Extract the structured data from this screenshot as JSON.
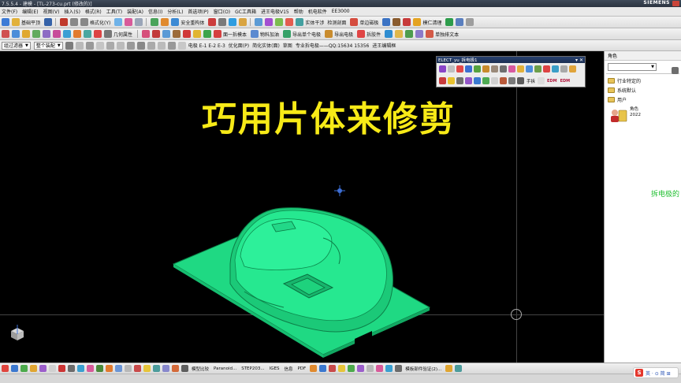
{
  "window": {
    "title": "7.5.5.4 - 建模 - [TL-273-cu.prt  (修改的)]",
    "brand": "SIEMENS"
  },
  "menu": [
    "文件(F)",
    "编辑(E)",
    "视图(V)",
    "插入(S)",
    "格式(R)",
    "工具(T)",
    "装配(A)",
    "信息(I)",
    "分析(L)",
    "首选项(P)",
    "窗口(O)",
    "GC工具箱",
    "进王电极V15",
    "帮助",
    "机电软件",
    "EE3000"
  ],
  "toolbar1": {
    "labels": [
      "基础平顶",
      "格式化(Y)",
      "安全重构体",
      "实体干涉",
      "检测剖面",
      "单边磁极",
      "模仁清理"
    ]
  },
  "toolbar2": {
    "labels": [
      "几何属性",
      "面一拆模本",
      "物料加油",
      "导出单个电极",
      "导出电极",
      "拆胶件",
      "单独排文本"
    ]
  },
  "toolbar3": {
    "filter": "整个装配",
    "filter_left": "组过滤器",
    "labels": [
      "电极  E-1  E-2  E-3",
      "优化面(P)",
      "简化实体(面)",
      "草图",
      "专业拆电极——QQ:15634 15356",
      "进王编辑框"
    ]
  },
  "elect_toolbar": {
    "title": "ELECT_yu_拆电极1",
    "text": "手拆",
    "edm1": "EDM",
    "edm2": "EDM"
  },
  "viewport": {
    "headline": "巧用片体来修剪",
    "model_color": "#22e58c",
    "plate_color": "#1fd983"
  },
  "right_panel": {
    "header": "角色",
    "items": [
      "行业特定的",
      "系统默认",
      "用户"
    ],
    "role_name": "角色",
    "role_year": "2022",
    "side_text": "拆电极的"
  },
  "bottombar": {
    "labels": [
      "模型比较",
      "Paranoid...",
      "STEP203...",
      "IGES",
      "信息",
      "PDF",
      "模板部件验证(2)..."
    ]
  },
  "ime": {
    "logo": "S",
    "text": "英 · ⊙ 简 ⊞"
  }
}
